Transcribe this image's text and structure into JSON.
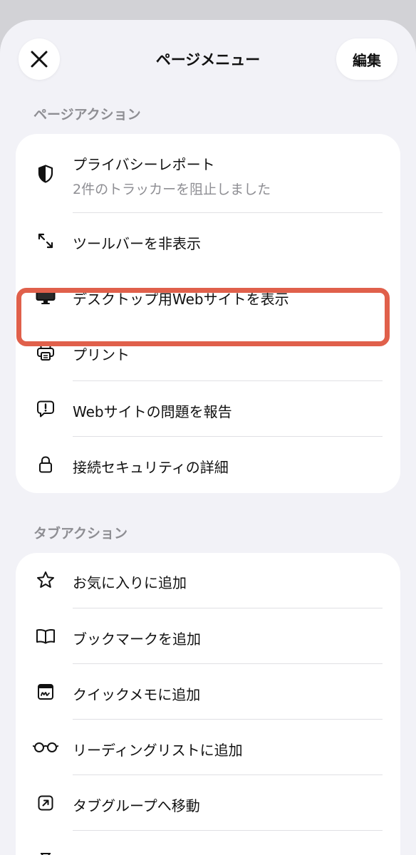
{
  "header": {
    "title": "ページメニュー",
    "edit_label": "編集"
  },
  "page_actions": {
    "section_title": "ページアクション",
    "items": [
      {
        "label": "プライバシーレポート",
        "sub": "2件のトラッカーを阻止しました",
        "icon": "shield-icon"
      },
      {
        "label": "ツールバーを非表示",
        "icon": "arrows-diagonal-icon"
      },
      {
        "label": "デスクトップ用Webサイトを表示",
        "icon": "desktop-icon"
      },
      {
        "label": "プリント",
        "icon": "printer-icon"
      },
      {
        "label": "Webサイトの問題を報告",
        "icon": "exclamation-bubble-icon"
      },
      {
        "label": "接続セキュリティの詳細",
        "icon": "lock-icon"
      }
    ]
  },
  "tab_actions": {
    "section_title": "タブアクション",
    "items": [
      {
        "label": "お気に入りに追加",
        "icon": "star-icon"
      },
      {
        "label": "ブックマークを追加",
        "icon": "book-icon"
      },
      {
        "label": "クイックメモに追加",
        "icon": "quick-note-icon"
      },
      {
        "label": "リーディングリストに追加",
        "icon": "glasses-icon"
      },
      {
        "label": "タブグループへ移動",
        "icon": "tab-group-arrow-icon"
      }
    ]
  },
  "colors": {
    "highlight": "#e0604b",
    "background": "#f2f2f7",
    "card": "#ffffff",
    "secondary_text": "#8e8e93"
  }
}
